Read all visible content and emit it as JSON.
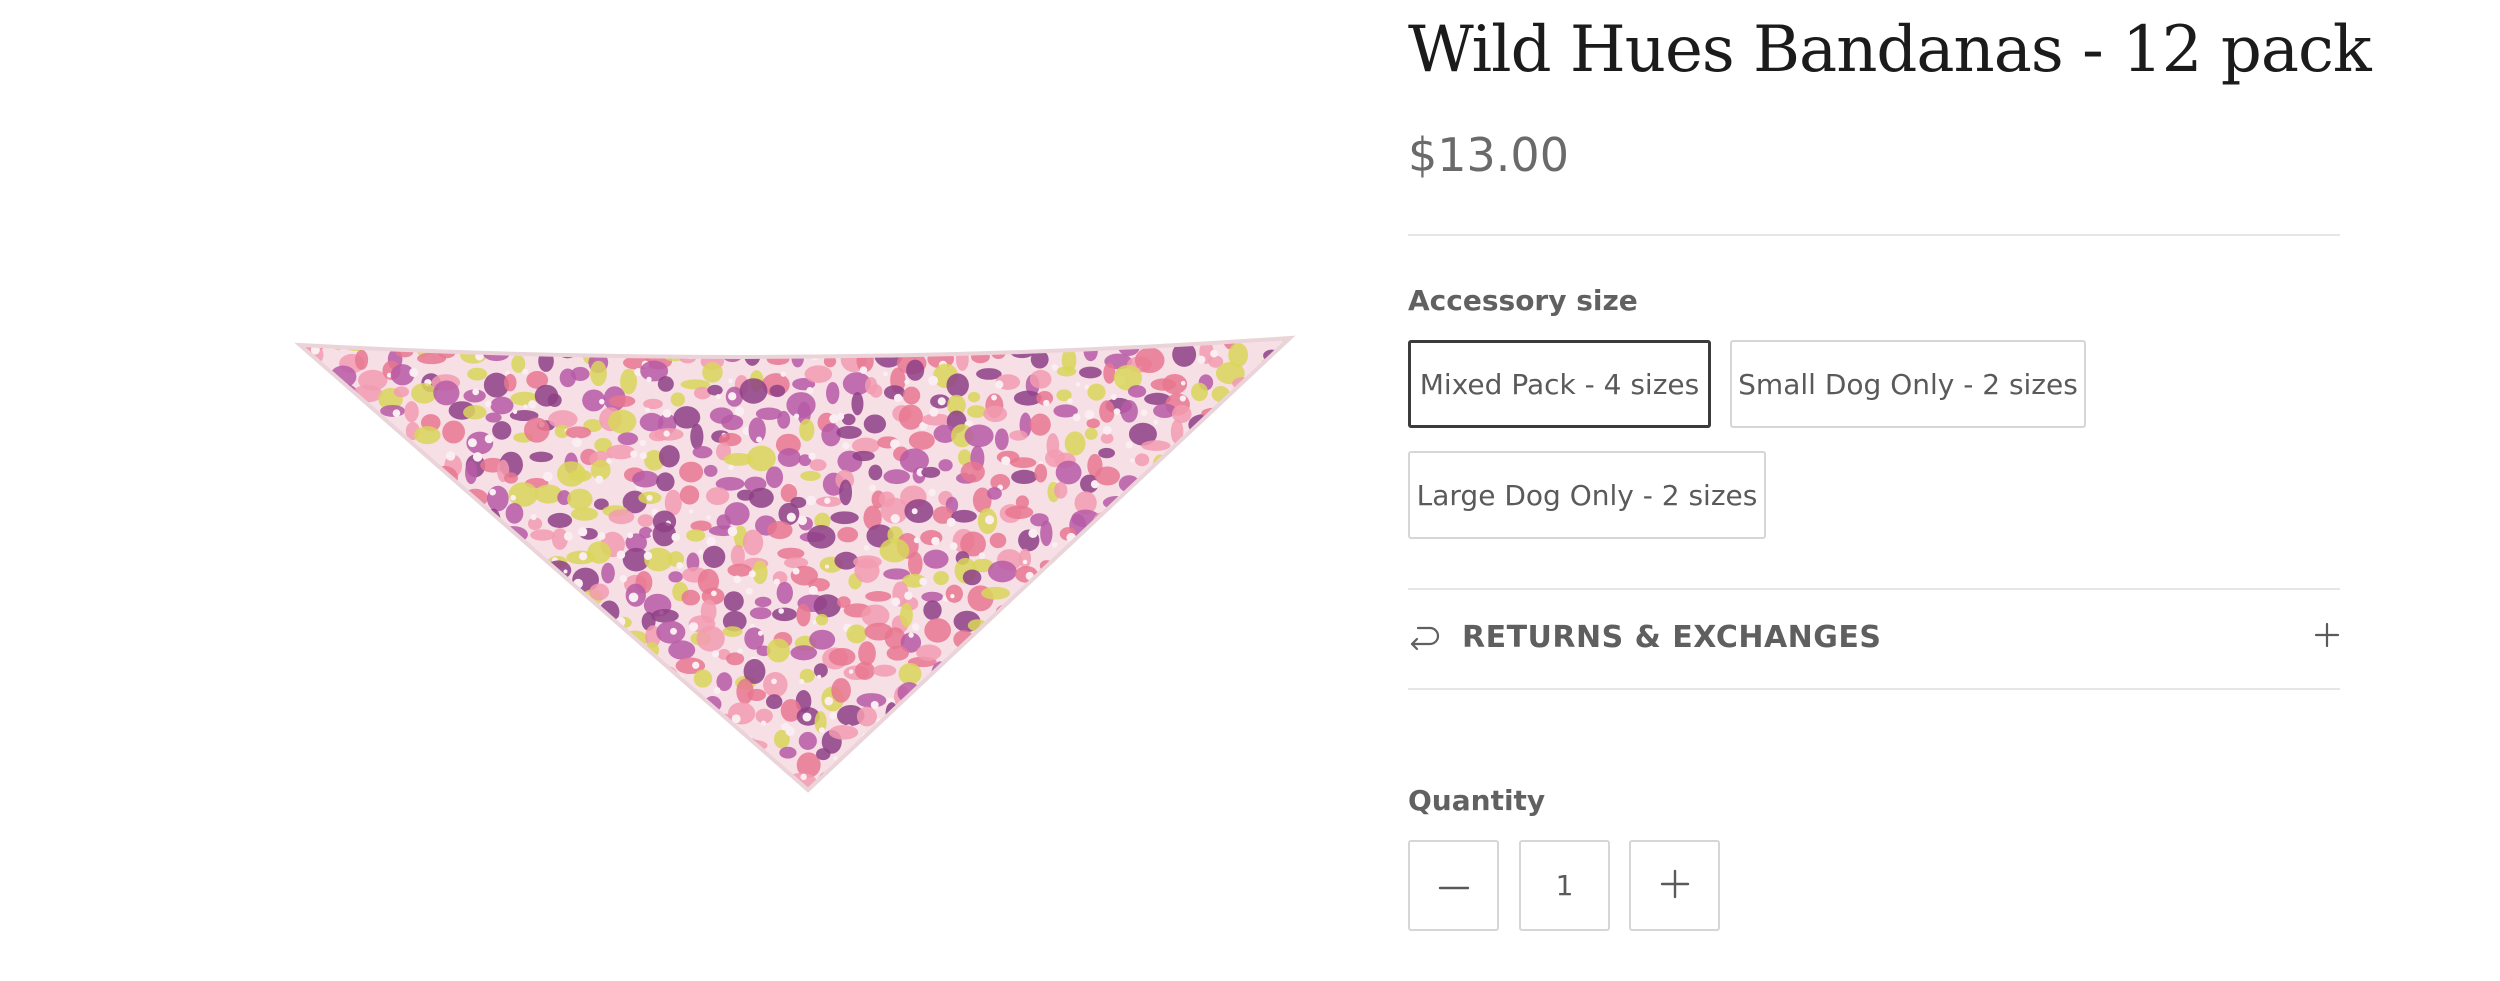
{
  "product": {
    "title": "Wild Hues Bandanas - 12 pack",
    "price": "$13.00",
    "image_alt": "floral print bandana"
  },
  "variant": {
    "label": "Accessory size",
    "options": [
      {
        "label": "Mixed Pack - 4 sizes",
        "selected": true
      },
      {
        "label": "Small Dog Only - 2 sizes",
        "selected": false
      },
      {
        "label": "Large Dog Only - 2 sizes",
        "selected": false
      }
    ]
  },
  "accordion": {
    "label": "RETURNS & EXCHANGES",
    "icon": "return-arrow-icon",
    "toggle_icon": "plus-icon"
  },
  "quantity": {
    "label": "Quantity",
    "value": "1",
    "decrease_icon": "minus-icon",
    "increase_icon": "plus-icon"
  },
  "colors": {
    "title": "#1b1b1b",
    "text": "#5d5d5d",
    "border": "#d6d6d6",
    "selected_border": "#3b3b3b",
    "pattern_purple": "#8e3f86",
    "pattern_pink": "#e8778f",
    "pattern_yellow": "#d9d65a"
  }
}
